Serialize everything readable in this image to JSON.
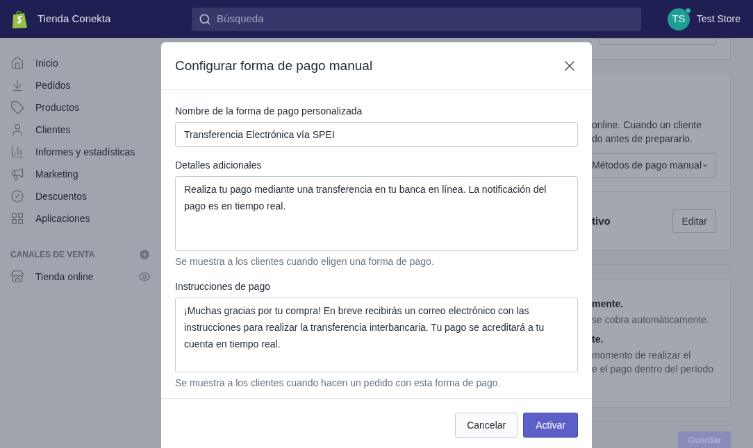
{
  "topbar": {
    "store_name": "Tienda Conekta",
    "search": {
      "placeholder": "Búsqueda"
    },
    "avatar": {
      "initials": "TS"
    },
    "account": "Test Store"
  },
  "sidebar": {
    "items": [
      {
        "label": "Inicio"
      },
      {
        "label": "Pedidos"
      },
      {
        "label": "Productos"
      },
      {
        "label": "Clientes"
      },
      {
        "label": "Informes y estadísticas"
      },
      {
        "label": "Marketing"
      },
      {
        "label": "Descuentos"
      },
      {
        "label": "Aplicaciones"
      }
    ],
    "section": {
      "heading": "CANALES DE VENTA",
      "items": [
        {
          "label": "Tienda online"
        }
      ]
    }
  },
  "background": {
    "line_1": "online. Cuando un cliente",
    "line_2": "do antes de prepararlo.",
    "dropdown": "Métodos de pago manual",
    "status": "tivo",
    "edit_button": "Editar",
    "option_1_title": "mente.",
    "option_1_text": "se cobra automáticamente.",
    "option_2_title": "te.",
    "option_2_text_1": "momento de realizar el",
    "option_2_text_2": "e el pago dentro del período",
    "save_button": "Guardar"
  },
  "modal": {
    "title": "Configurar forma de pago manual",
    "fields": [
      {
        "kind": "input",
        "label": "Nombre de la forma de pago personalizada",
        "value": "Transferencia Electrónica vía SPEI"
      },
      {
        "kind": "textarea",
        "label": "Detalles adicionales",
        "value": "Realiza tu pago mediante una transferencia en tu banca en línea. La notificación del pago es en tiempo real.",
        "hint": "Se muestra a los clientes cuando eligen una forma de pago."
      },
      {
        "kind": "textarea",
        "label": "Instrucciones de pago",
        "value": "¡Muchas gracias por tu compra! En breve recibirás un correo electrónico con las instrucciones para realizar la transferencia interbancaria. Tu pago se acreditará a tu cuenta en tiempo real.",
        "hint": "Se muestra a los clientes cuando hacen un pedido con esta forma de pago."
      }
    ],
    "buttons": [
      {
        "kind": "secondary",
        "label": "Cancelar"
      },
      {
        "kind": "primary",
        "label": "Activar"
      }
    ]
  }
}
